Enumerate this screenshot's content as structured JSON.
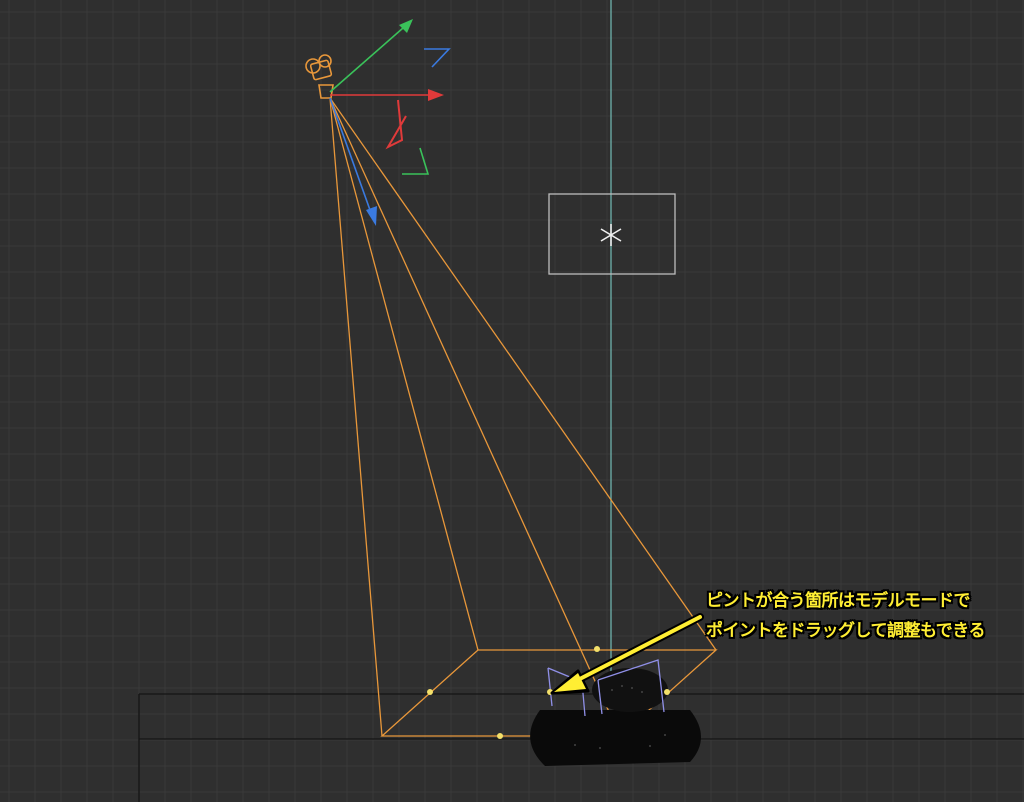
{
  "scene": {
    "background_color": "#2f2f2f",
    "grid_color": "#3a3a3a",
    "frustum_color": "#e8973a",
    "axis_colors": {
      "x": "#e03a3a",
      "y": "#3ac25a",
      "z": "#3a7ae0"
    },
    "focus_handle_color": "#f3e06a",
    "focus_plane_color": "#8080e0"
  },
  "annotation": {
    "line1": "ピントが合う箇所はモデルモードで",
    "line2": "ポイントをドラッグして調整もできる",
    "color": "#ffee33"
  }
}
